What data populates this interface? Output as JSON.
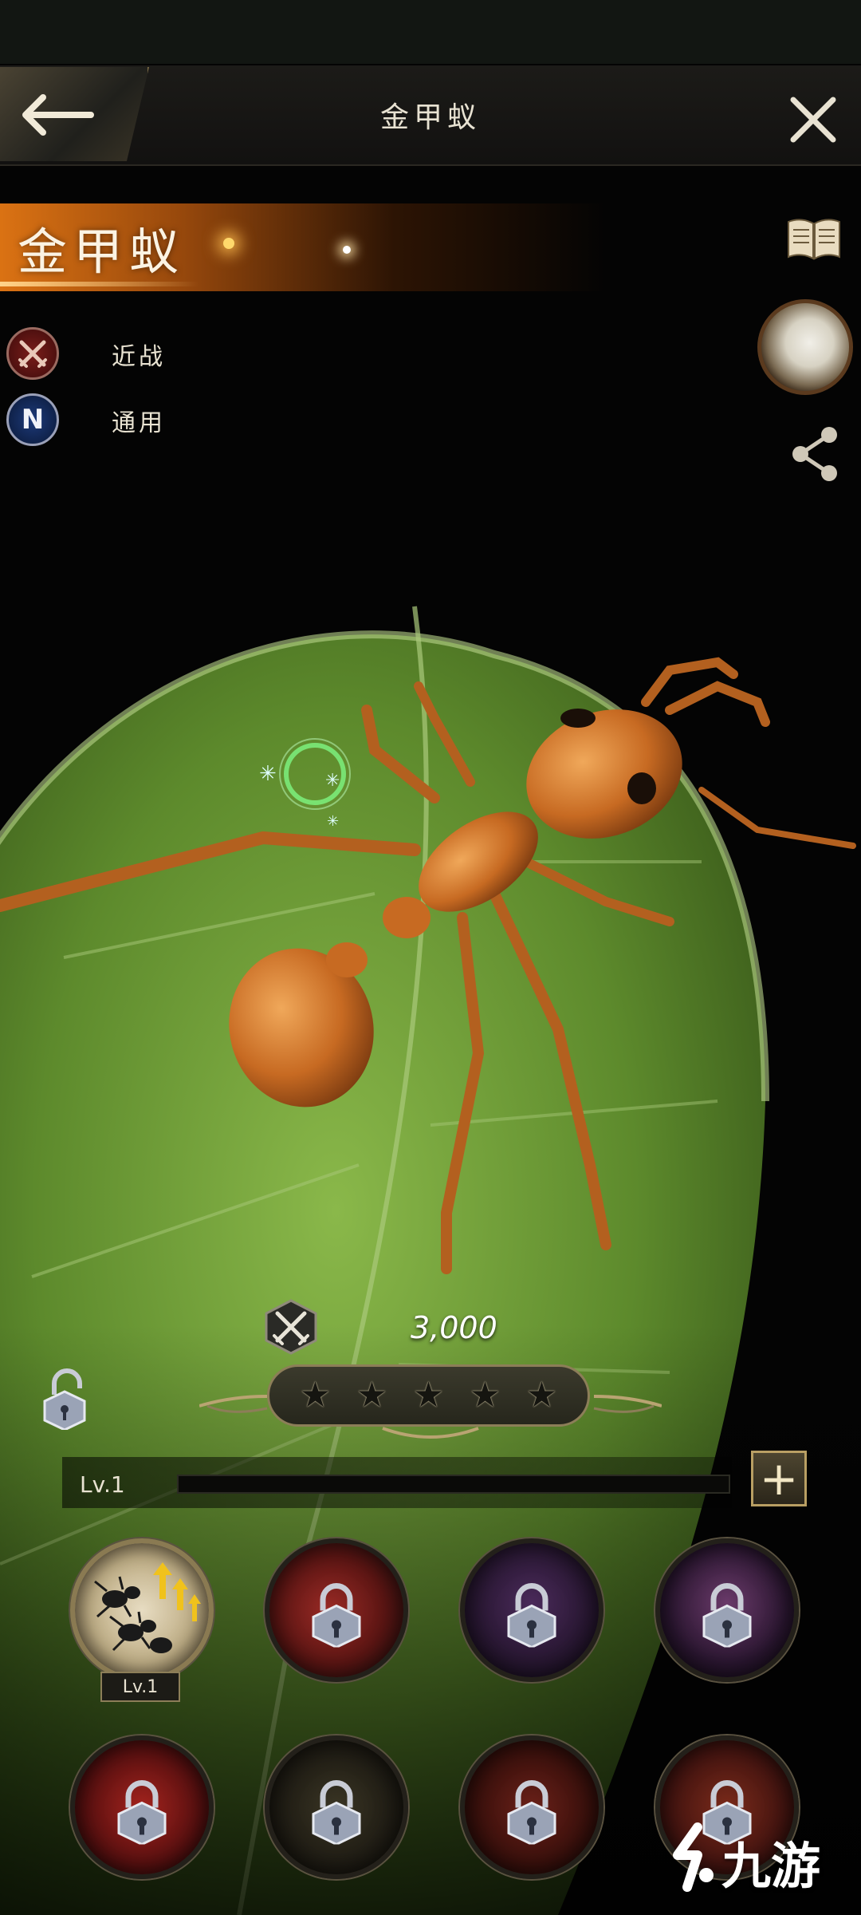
{
  "header": {
    "title": "金甲蚁",
    "back_icon": "arrow-left-icon",
    "close_icon": "close-x-icon"
  },
  "unit": {
    "name": "金甲蚁",
    "tags": [
      {
        "icon": "crossed-swords-icon",
        "label": "近战"
      },
      {
        "icon": "N",
        "label": "通用"
      }
    ]
  },
  "side_icons": [
    "book-icon",
    "avatar",
    "share-icon"
  ],
  "stats": {
    "power_icon": "crossed-swords-icon",
    "power": "3,000",
    "stars_total": 5,
    "stars_filled": 0
  },
  "level": {
    "label": "Lv.1",
    "progress": 0,
    "plus_label": "+"
  },
  "skills": [
    {
      "id": "skill-1",
      "locked": false,
      "level": "Lv.1"
    },
    {
      "id": "skill-2",
      "locked": true
    },
    {
      "id": "skill-3",
      "locked": true
    },
    {
      "id": "skill-4",
      "locked": true
    },
    {
      "id": "skill-5",
      "locked": true
    },
    {
      "id": "skill-6",
      "locked": true
    },
    {
      "id": "skill-7",
      "locked": true
    },
    {
      "id": "skill-8",
      "locked": true
    }
  ],
  "watermark": {
    "text": "九游"
  },
  "colors": {
    "accent_orange": "#e67814",
    "gold_border": "#8c7e58",
    "leaf_green": "#5d8a2c"
  }
}
